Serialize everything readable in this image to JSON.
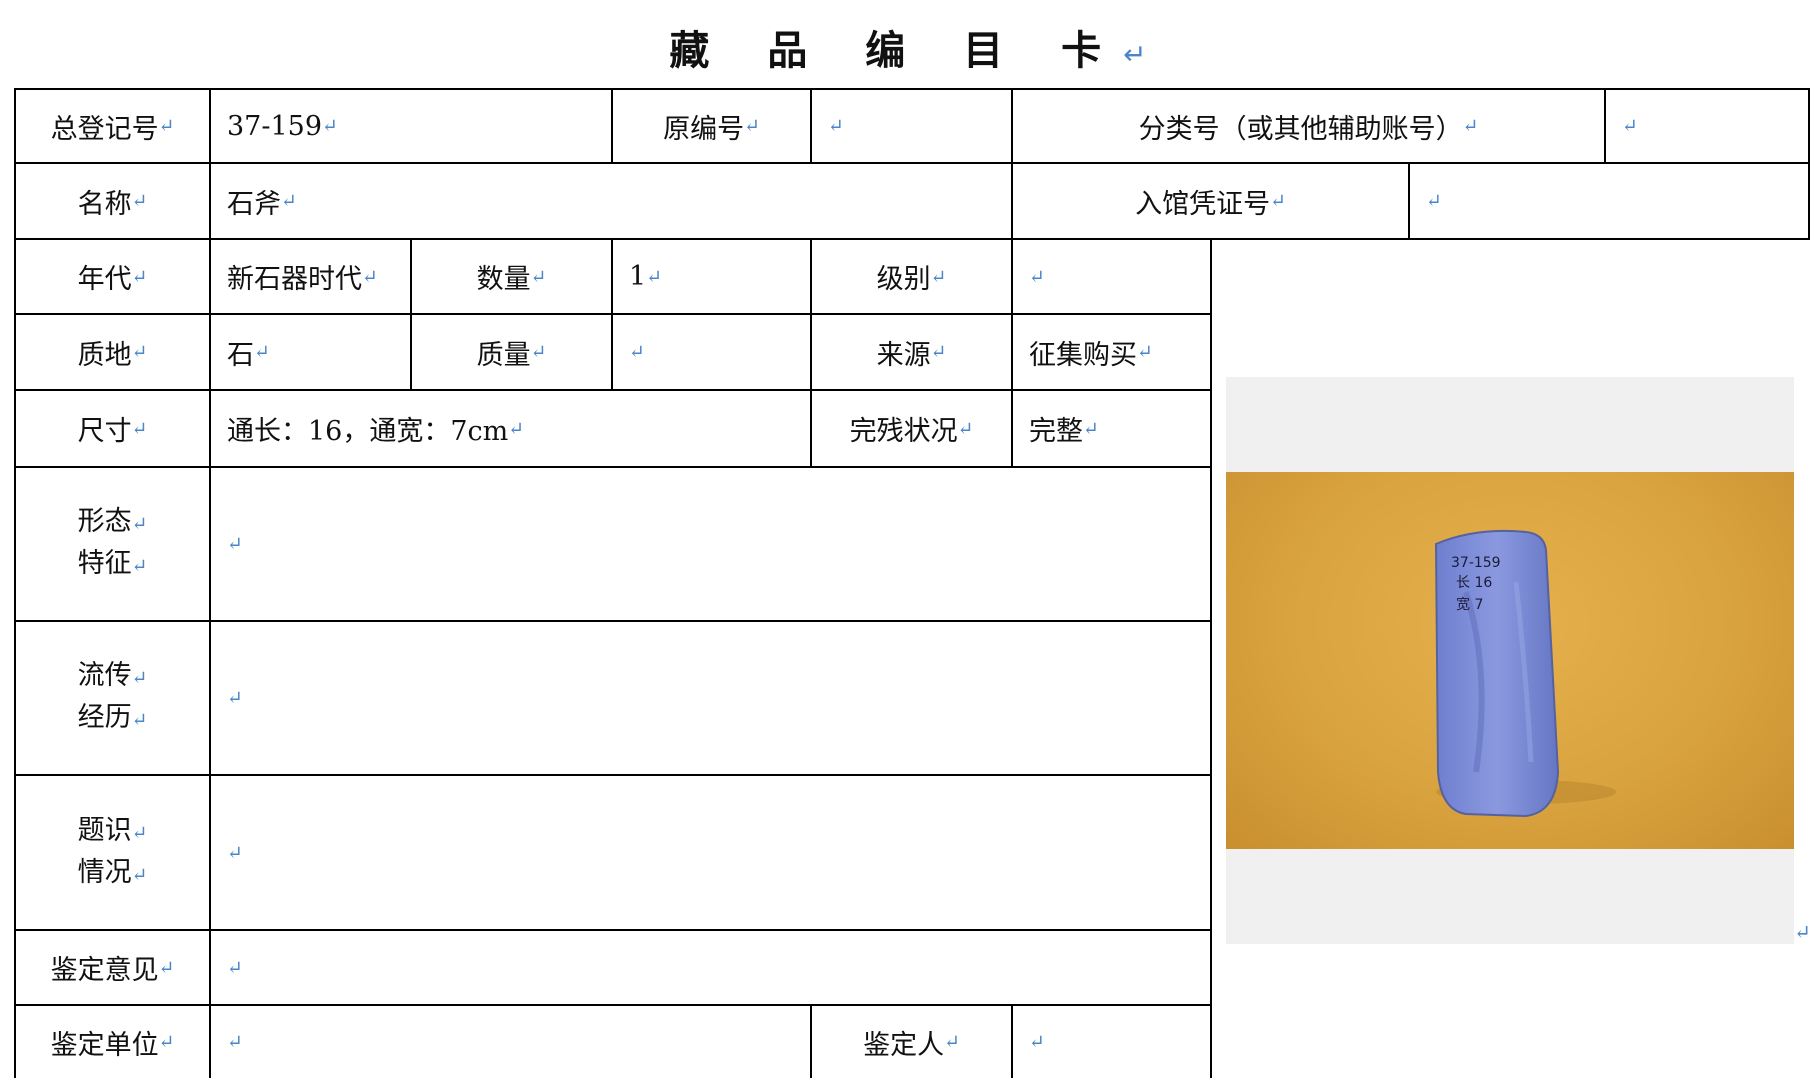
{
  "title": "藏 品 编 目 卡",
  "pilcrow": "↵",
  "card": {
    "registration_no_label": "总登记号",
    "registration_no_value": "37-159",
    "original_no_label": "原编号",
    "original_no_value": "",
    "classification_label": "分类号（或其他辅助账号）",
    "classification_value": "",
    "name_label": "名称",
    "name_value": "石斧",
    "accession_voucher_label": "入馆凭证号",
    "accession_voucher_value": "",
    "period_label": "年代",
    "period_value": "新石器时代",
    "quantity_label": "数量",
    "quantity_value": "1",
    "grade_label": "级别",
    "grade_value": "",
    "material_label": "质地",
    "material_value": "石",
    "weight_label": "质量",
    "weight_value": "",
    "source_label": "来源",
    "source_value": "征集购买",
    "dimensions_label": "尺寸",
    "dimensions_value": "通长：16，通宽：7cm",
    "condition_label": "完残状况",
    "condition_value": "完整",
    "form_label_1": "形态",
    "form_label_2": "特征",
    "form_value": "",
    "provenance_label_1": "流传",
    "provenance_label_2": "经历",
    "provenance_value": "",
    "inscription_label_1": "题识",
    "inscription_label_2": "情况",
    "inscription_value": "",
    "appraisal_opinion_label": "鉴定意见",
    "appraisal_opinion_value": "",
    "appraisal_unit_label": "鉴定单位",
    "appraisal_unit_value": "",
    "appraiser_label": "鉴定人",
    "appraiser_value": ""
  },
  "photo": {
    "caption_marks": [
      "37-159",
      "长 16",
      "宽 7"
    ],
    "background_color": "#d9a33f",
    "object_color": "#7f8fd6"
  }
}
